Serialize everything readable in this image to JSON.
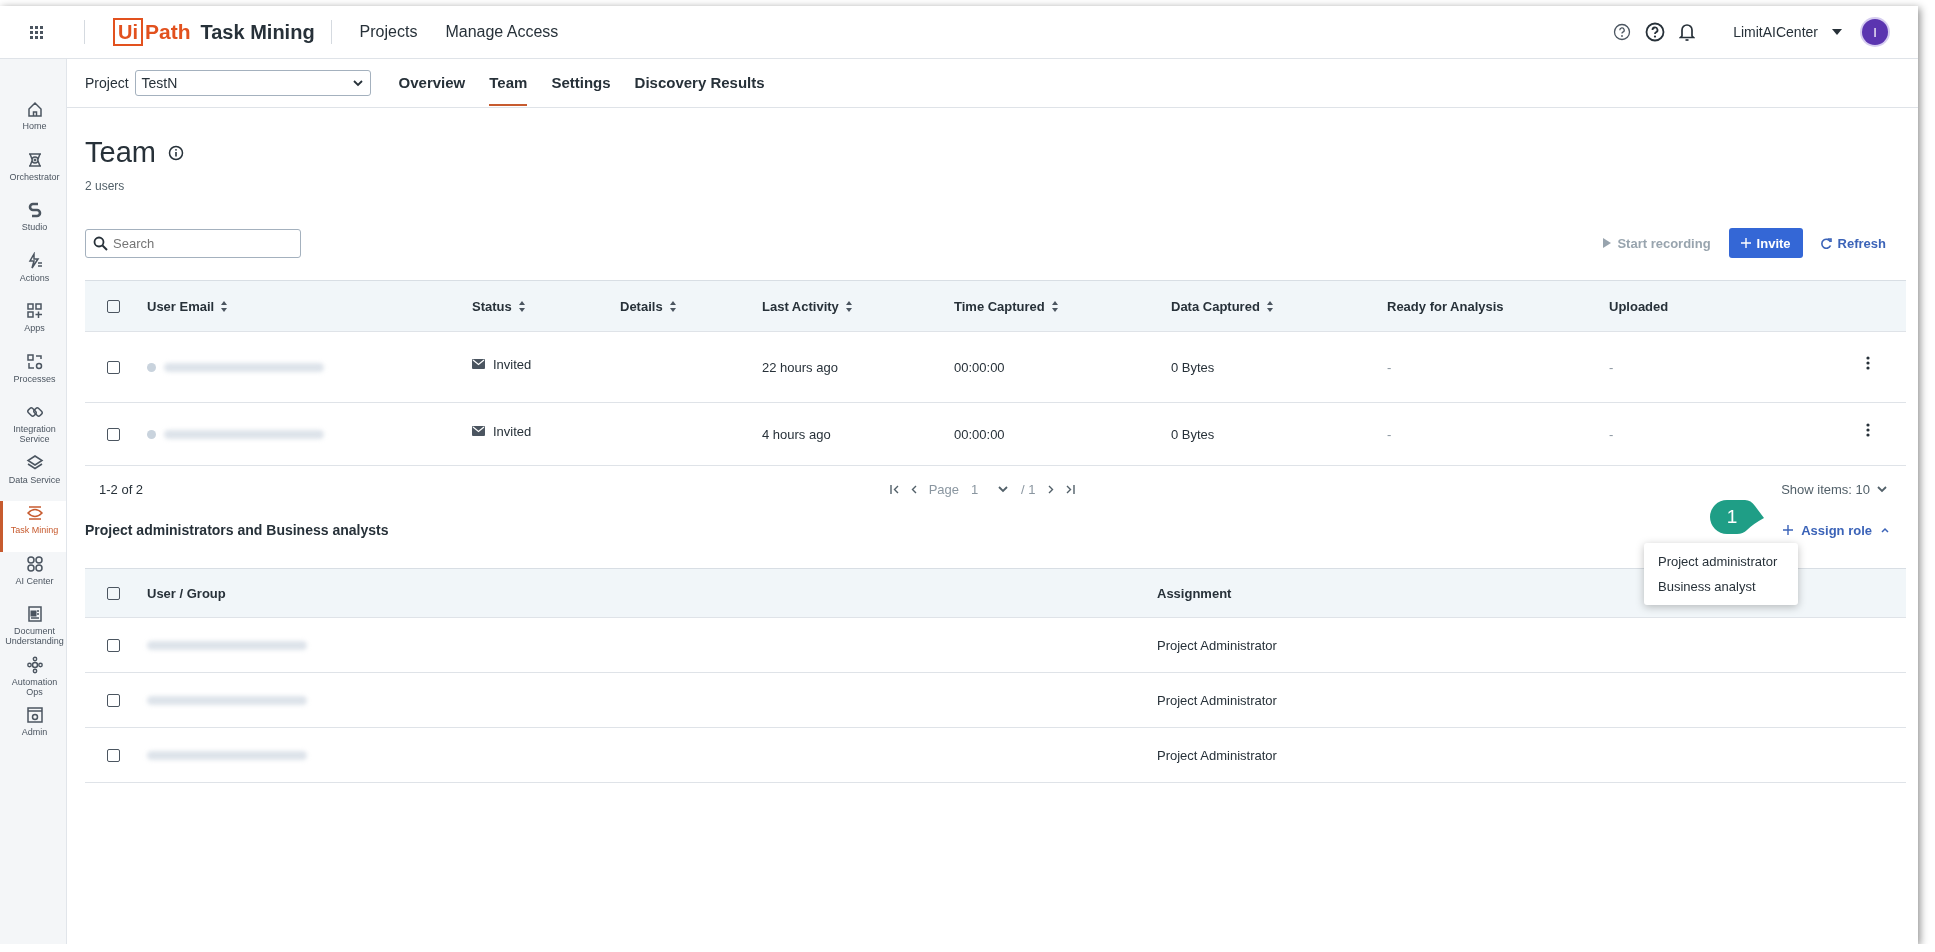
{
  "top_bar": {
    "brand": {
      "logo_box": "Ui",
      "logo_rest": "Path",
      "product": "Task Mining"
    },
    "nav": [
      {
        "label": "Projects"
      },
      {
        "label": "Manage Access"
      }
    ],
    "user": {
      "name": "LimitAICenter",
      "avatar": "I"
    }
  },
  "sidebar": {
    "items": [
      {
        "label": "Home",
        "selected": false
      },
      {
        "label": "Orchestrator",
        "selected": false
      },
      {
        "label": "Studio",
        "selected": false
      },
      {
        "label": "Actions",
        "selected": false
      },
      {
        "label": "Apps",
        "selected": false
      },
      {
        "label": "Processes",
        "selected": false
      },
      {
        "label": "Integration Service",
        "selected": false
      },
      {
        "label": "Data Service",
        "selected": false
      },
      {
        "label": "Task Mining",
        "selected": true
      },
      {
        "label": "AI Center",
        "selected": false
      },
      {
        "label": "Document Understanding",
        "selected": false
      },
      {
        "label": "Automation Ops",
        "selected": false
      },
      {
        "label": "Admin",
        "selected": false
      }
    ]
  },
  "project_bar": {
    "label": "Project",
    "value": "TestN",
    "tabs": [
      {
        "label": "Overview",
        "selected": false
      },
      {
        "label": "Team",
        "selected": true
      },
      {
        "label": "Settings",
        "selected": false
      },
      {
        "label": "Discovery Results",
        "selected": false
      }
    ]
  },
  "page": {
    "title": "Team",
    "subtitle": "2 users"
  },
  "search": {
    "placeholder": "Search"
  },
  "actions": [
    {
      "label": "Start recording",
      "kind": "play",
      "disabled": true
    },
    {
      "label": "Invite",
      "kind": "primary"
    },
    {
      "label": "Refresh",
      "kind": "refresh"
    }
  ],
  "users_table": {
    "select_all_checked": false,
    "columns": [
      {
        "label": "User Email",
        "sortable": true
      },
      {
        "label": "Status",
        "sortable": true
      },
      {
        "label": "Details",
        "sortable": true
      },
      {
        "label": "Last Activity",
        "sortable": true
      },
      {
        "label": "Time Captured",
        "sortable": true
      },
      {
        "label": "Data Captured",
        "sortable": true
      },
      {
        "label": "Ready for Analysis",
        "sortable": false
      },
      {
        "label": "Uploaded",
        "sortable": false
      }
    ],
    "rows": [
      {
        "checked": false,
        "color": "#c9d3dd",
        "status": "Invited",
        "last_activity": "22 hours ago",
        "time_captured": "00:00:00",
        "data_captured": "0 Bytes",
        "ready": "-",
        "uploaded": "-"
      },
      {
        "checked": false,
        "color": "#c9d3dd",
        "status": "Invited",
        "last_activity": "4 hours ago",
        "time_captured": "00:00:00",
        "data_captured": "0 Bytes",
        "ready": "-",
        "uploaded": "-"
      }
    ],
    "range": "1-2 of 2",
    "page_label": "Page",
    "page": "1",
    "page_total": "/ 1",
    "show_items": "Show items: 10"
  },
  "roles_section": {
    "title": "Project administrators and Business analysts",
    "assign": {
      "label": "Assign role",
      "expanded": true
    },
    "menu": [
      {
        "label": "Project administrator"
      },
      {
        "label": "Business analyst"
      }
    ],
    "select_all_checked": false,
    "columns": [
      {
        "label": "User / Group"
      },
      {
        "label": "Assignment"
      }
    ],
    "rows": [
      {
        "checked": false,
        "assignment": "Project Administrator"
      },
      {
        "checked": false,
        "assignment": "Project Administrator"
      },
      {
        "checked": false,
        "assignment": "Project Administrator"
      }
    ]
  },
  "callout": {
    "label": "1"
  }
}
